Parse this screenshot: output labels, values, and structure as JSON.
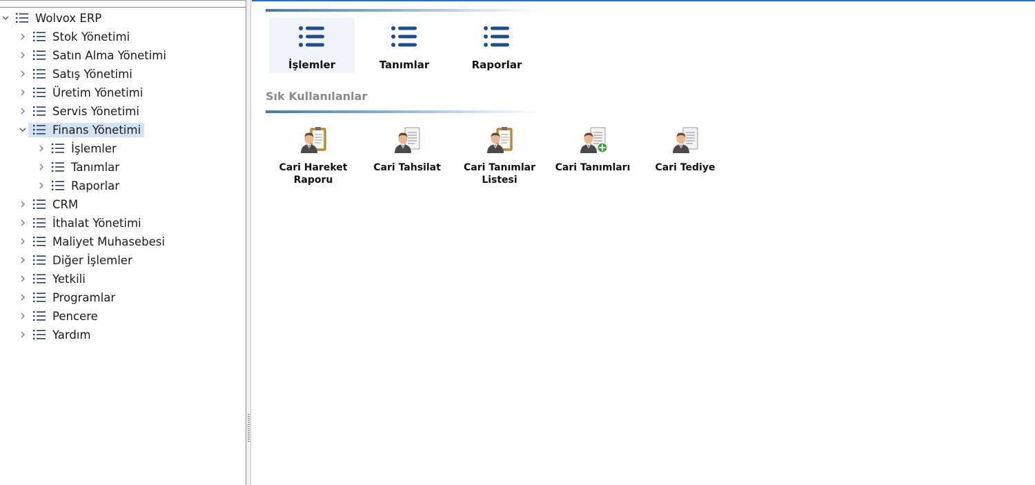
{
  "tree": {
    "root": {
      "label": "Wolvox ERP",
      "expanded": true
    },
    "items": [
      {
        "label": "Stok Yönetimi",
        "level": 1,
        "expanded": false,
        "selected": false
      },
      {
        "label": "Satın Alma Yönetimi",
        "level": 1,
        "expanded": false,
        "selected": false
      },
      {
        "label": "Satış Yönetimi",
        "level": 1,
        "expanded": false,
        "selected": false
      },
      {
        "label": "Üretim Yönetimi",
        "level": 1,
        "expanded": false,
        "selected": false
      },
      {
        "label": "Servis Yönetimi",
        "level": 1,
        "expanded": false,
        "selected": false
      },
      {
        "label": "Finans Yönetimi",
        "level": 1,
        "expanded": true,
        "selected": true
      },
      {
        "label": "İşlemler",
        "level": 2,
        "expanded": false,
        "selected": false
      },
      {
        "label": "Tanımlar",
        "level": 2,
        "expanded": false,
        "selected": false
      },
      {
        "label": "Raporlar",
        "level": 2,
        "expanded": false,
        "selected": false
      },
      {
        "label": "CRM",
        "level": 1,
        "expanded": false,
        "selected": false
      },
      {
        "label": "İthalat Yönetimi",
        "level": 1,
        "expanded": false,
        "selected": false
      },
      {
        "label": "Maliyet Muhasebesi",
        "level": 1,
        "expanded": false,
        "selected": false
      },
      {
        "label": "Diğer İşlemler",
        "level": 1,
        "expanded": false,
        "selected": false
      },
      {
        "label": "Yetkili",
        "level": 1,
        "expanded": false,
        "selected": false
      },
      {
        "label": "Programlar",
        "level": 1,
        "expanded": false,
        "selected": false
      },
      {
        "label": "Pencere",
        "level": 1,
        "expanded": false,
        "selected": false
      },
      {
        "label": "Yardım",
        "level": 1,
        "expanded": false,
        "selected": false
      }
    ]
  },
  "main": {
    "tiles": [
      {
        "label": "İşlemler",
        "icon": "list-icon",
        "active": true
      },
      {
        "label": "Tanımlar",
        "icon": "list-icon",
        "active": false
      },
      {
        "label": "Raporlar",
        "icon": "list-icon",
        "active": false
      }
    ],
    "favorites_title": "Sık Kullanılanlar",
    "favorites": [
      {
        "label": "Cari Hareket Raporu",
        "lines": [
          "Cari Hareket",
          "Raporu"
        ],
        "icon": "user-clipboard-icon"
      },
      {
        "label": "Cari Tahsilat",
        "lines": [
          "Cari Tahsilat"
        ],
        "icon": "user-document-icon"
      },
      {
        "label": "Cari Tanımlar Listesi",
        "lines": [
          "Cari Tanımlar",
          "Listesi"
        ],
        "icon": "user-clipboard-icon"
      },
      {
        "label": "Cari Tanımları",
        "lines": [
          "Cari Tanımları"
        ],
        "icon": "user-add-icon"
      },
      {
        "label": "Cari Tediye",
        "lines": [
          "Cari Tediye"
        ],
        "icon": "user-document-icon"
      }
    ]
  },
  "colors": {
    "accent": "#2a6ebb",
    "icon_blue": "#1f4f8a",
    "selection": "#d3e3f4",
    "section_title": "#8a8a8a"
  }
}
